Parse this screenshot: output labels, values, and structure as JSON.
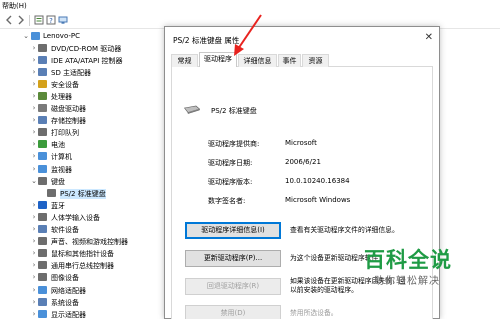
{
  "menubar": {
    "help": "帮助(H)"
  },
  "tree": {
    "root": "Lenovo-PC",
    "items": [
      {
        "label": "DVD/CD-ROM 驱动器",
        "icon": "disc-drive-icon",
        "color": "#6d6d6d"
      },
      {
        "label": "IDE ATA/ATAPI 控制器",
        "icon": "controller-icon",
        "color": "#5a7fb5"
      },
      {
        "label": "SD 主适配器",
        "icon": "sd-card-icon",
        "color": "#5a7fb5"
      },
      {
        "label": "安全设备",
        "icon": "security-icon",
        "color": "#d4a11b"
      },
      {
        "label": "处理器",
        "icon": "processor-icon",
        "color": "#5b8a3a"
      },
      {
        "label": "磁盘驱动器",
        "icon": "disk-icon",
        "color": "#7a7a7a"
      },
      {
        "label": "存储控制器",
        "icon": "storage-icon",
        "color": "#5a7fb5"
      },
      {
        "label": "打印队列",
        "icon": "printer-icon",
        "color": "#6d6d6d"
      },
      {
        "label": "电池",
        "icon": "battery-icon",
        "color": "#3b9b3b"
      },
      {
        "label": "计算机",
        "icon": "computer-icon",
        "color": "#4a90d9"
      },
      {
        "label": "监视器",
        "icon": "monitor-icon",
        "color": "#4a90d9"
      },
      {
        "label": "键盘",
        "icon": "keyboard-icon",
        "color": "#6d6d6d"
      },
      {
        "label": "PS/2 标准键盘",
        "icon": "keyboard-icon",
        "color": "#6d6d6d"
      },
      {
        "label": "蓝牙",
        "icon": "bluetooth-icon",
        "color": "#1e62c6"
      },
      {
        "label": "人体学输入设备",
        "icon": "hid-icon",
        "color": "#6d6d6d"
      },
      {
        "label": "软件设备",
        "icon": "software-device-icon",
        "color": "#5a7fb5"
      },
      {
        "label": "声音、视频和游戏控制器",
        "icon": "sound-icon",
        "color": "#6d6d6d"
      },
      {
        "label": "鼠标和其他指针设备",
        "icon": "mouse-icon",
        "color": "#6d6d6d"
      },
      {
        "label": "通用串行总线控制器",
        "icon": "usb-icon",
        "color": "#6d6d6d"
      },
      {
        "label": "图像设备",
        "icon": "camera-icon",
        "color": "#6d6d6d"
      },
      {
        "label": "网络适配器",
        "icon": "network-icon",
        "color": "#4a90d9"
      },
      {
        "label": "系统设备",
        "icon": "system-device-icon",
        "color": "#5a7fb5"
      },
      {
        "label": "显示适配器",
        "icon": "display-adapter-icon",
        "color": "#4a90d9"
      }
    ]
  },
  "dialog": {
    "title": "PS/2 标准键盘 属性",
    "close": "✕",
    "tabs": [
      "常规",
      "驱动程序",
      "详细信息",
      "事件",
      "资源"
    ],
    "active_tab": "驱动程序",
    "device_name": "PS/2 标准键盘",
    "properties": [
      {
        "label": "驱动程序提供商:",
        "value": "Microsoft"
      },
      {
        "label": "驱动程序日期:",
        "value": "2006/6/21"
      },
      {
        "label": "驱动程序版本:",
        "value": "10.0.10240.16384"
      },
      {
        "label": "数字签名者:",
        "value": "Microsoft Windows"
      }
    ],
    "buttons": [
      {
        "label": "驱动程序详细信息(I)",
        "desc": "查看有关驱动程序文件的详细信息。",
        "enabled": true
      },
      {
        "label": "更新驱动程序(P)...",
        "desc": "为这个设备更新驱动程序软件",
        "enabled": true
      },
      {
        "label": "回退驱动程序(R)",
        "desc": "如果该设备在更新驱动程序后失败，回\n以前安装的驱动程序。",
        "enabled": false
      },
      {
        "label": "禁用(D)",
        "desc": "禁用所选设备。",
        "enabled": false
      }
    ]
  },
  "watermark": {
    "title": "百科全说",
    "subtitle": "助你轻松解决"
  },
  "colors": {
    "accent": "#0078d7",
    "arrow": "#e8231f",
    "watermark": "#1f9b45"
  }
}
